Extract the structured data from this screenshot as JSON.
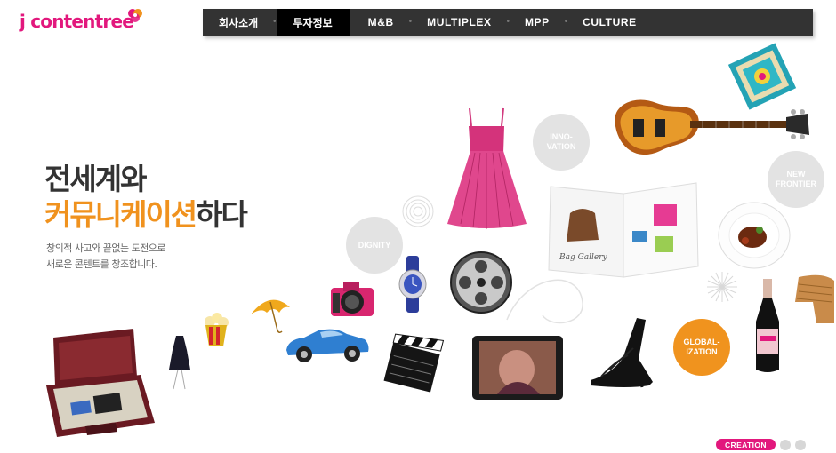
{
  "brand": {
    "logo_text": "j contentree",
    "accent_color": "#e2187d",
    "secondary_color": "#f0921e"
  },
  "nav": {
    "items": [
      "회사소개",
      "투자정보",
      "M&B",
      "MULTIPLEX",
      "MPP",
      "CULTURE"
    ],
    "active": "투자정보"
  },
  "hero": {
    "headline_line1": "전세계와",
    "headline_line2_highlight": "커뮤니케이션",
    "headline_line2_rest": "하다",
    "sub_line1": "창의적 사고와 끝없는 도전으로",
    "sub_line2": "새로운 콘텐트를 창조합니다."
  },
  "bubbles": {
    "innovation": "INNO-\nVATION",
    "new_frontier": "NEW\nFRONTIER",
    "dignity": "DIGNITY",
    "globalization": "GLOBAL-\nIZATION"
  },
  "magazine": {
    "caption": "Bag Gallery"
  },
  "pagination": {
    "active_label": "CREATION",
    "total_dots": 3
  },
  "icons": [
    "briefcase-icon",
    "dress-icon",
    "guitar-icon",
    "scarf-icon",
    "magazine-icon",
    "watch-icon",
    "camera-icon",
    "car-icon",
    "umbrella-icon",
    "popcorn-icon",
    "clapperboard-icon",
    "film-reel-icon",
    "tablet-icon",
    "heels-icon",
    "champagne-icon",
    "food-plate-icon",
    "chair-icon",
    "small-dress-icon"
  ]
}
